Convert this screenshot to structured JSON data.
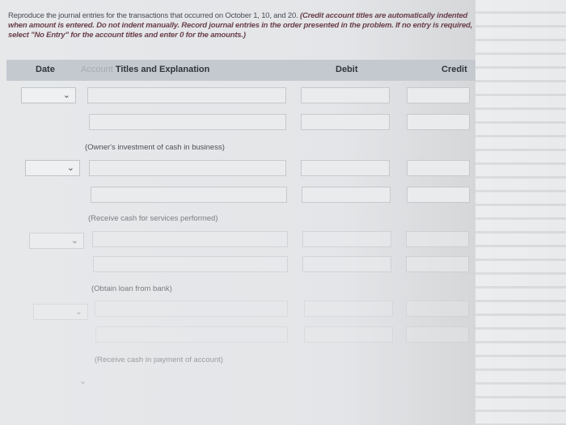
{
  "instructions": {
    "lead": "Reproduce the journal entries for the transactions that occurred on October 1, 10, and 20.",
    "emph": "(Credit account titles are automatically indented when amount is entered. Do not indent manually. Record journal entries in the order presented in the problem. If no entry is required, select \"No Entry\" for the account titles and enter 0 for the amounts.)"
  },
  "table": {
    "headers": {
      "date": "Date",
      "account_faded": "Account",
      "account": "Titles and Explanation",
      "debit": "Debit",
      "credit": "Credit"
    },
    "entries": [
      {
        "explanation": "(Owner's investment of cash in business)"
      },
      {
        "explanation": "(Receive cash for services performed)"
      },
      {
        "explanation": "(Obtain loan from bank)"
      },
      {
        "explanation": "(Receive cash in payment of account)"
      }
    ]
  },
  "icons": {
    "dropdown": "chevron-down-icon"
  }
}
